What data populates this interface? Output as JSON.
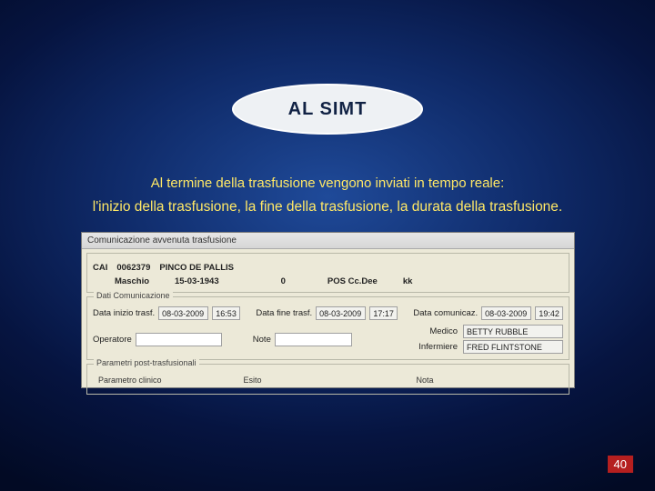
{
  "bubble": {
    "title": "AL  SIMT"
  },
  "captions": {
    "line1": "Al termine della trasfusione vengono inviati in tempo reale:",
    "line2": "l'inizio della trasfusione, la fine della trasfusione, la durata della trasfusione."
  },
  "window": {
    "title": "Comunicazione avvenuta trasfusione",
    "patient": {
      "cai_label": "CAI",
      "cai_value": "0062379",
      "name": "PINCO DE PALLIS",
      "sex": "Maschio",
      "dob": "15-03-1943",
      "zero": "0",
      "pos_label": "POS Cc.Dee",
      "kk": "kk"
    },
    "comm": {
      "group_label": "Dati Comunicazione",
      "start_label": "Data inizio trasf.",
      "start_date": "08-03-2009",
      "start_time": "16:53",
      "end_label": "Data fine trasf.",
      "end_date": "08-03-2009",
      "end_time": "17:17",
      "comm_label": "Data comunicaz.",
      "comm_date": "08-03-2009",
      "comm_time": "19:42",
      "operator_label": "Operatore",
      "operator_value": "",
      "note_label": "Note",
      "note_value": "",
      "medico_label": "Medico",
      "medico_value": "BETTY RUBBLE",
      "infermiere_label": "Infermiere",
      "infermiere_value": "FRED FLINTSTONE"
    },
    "params": {
      "group_label": "Parametri post-trasfusionali",
      "col1": "Parametro clinico",
      "col2": "Esito",
      "col3": "Nota"
    }
  },
  "page_number": "40"
}
